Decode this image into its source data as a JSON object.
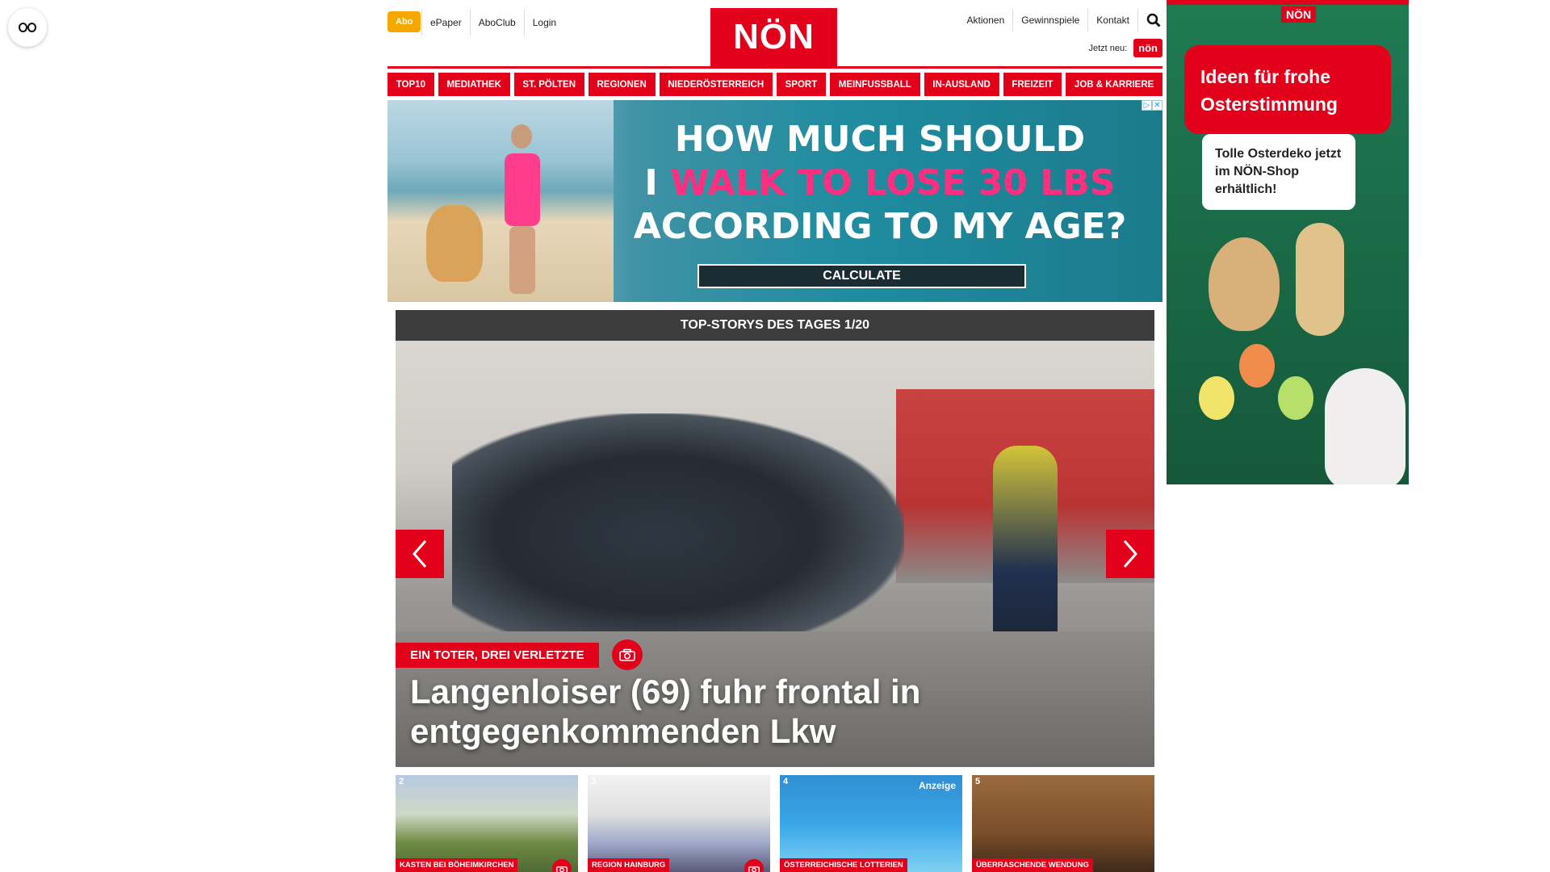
{
  "header": {
    "abo": "Abo",
    "links_left": [
      "ePaper",
      "AboClub",
      "Login"
    ],
    "logo": "NÖN",
    "links_right": [
      "Aktionen",
      "Gewinnspiele",
      "Kontakt"
    ],
    "jetzt_label": "Jetzt neu:",
    "jetzt_badge": "nön"
  },
  "nav": [
    "TOP10",
    "MEDIATHEK",
    "ST. PÖLTEN",
    "REGIONEN",
    "NIEDERÖSTERREICH",
    "SPORT",
    "MEINFUSSBALL",
    "IN-AUSLAND",
    "FREIZEIT",
    "JOB & KARRIERE"
  ],
  "banner": {
    "line1": "HOW MUCH SHOULD",
    "line2_pre": "I",
    "line2_pink": "WALK TO LOSE 30 LBS",
    "line3": "ACCORDING TO MY AGE?",
    "button": "CALCULATE"
  },
  "top_stories": {
    "header": "TOP-STORYS DES TAGES 1/20",
    "kicker": "EIN TOTER, DREI VERLETZTE",
    "title": "Langenloiser (69) fuhr frontal in entgegenkommenden Lkw"
  },
  "thumbs": [
    {
      "num": "2",
      "tag": "KASTEN BEI BÖHEIMKIRCHEN",
      "has_cam": true,
      "ad": ""
    },
    {
      "num": "3",
      "tag": "REGION HAINBURG",
      "has_cam": true,
      "ad": ""
    },
    {
      "num": "4",
      "tag": "ÖSTERREICHISCHE LOTTERIEN",
      "has_cam": false,
      "ad": "Anzeige"
    },
    {
      "num": "5",
      "tag": "ÜBERRASCHENDE WENDUNG",
      "has_cam": false,
      "ad": ""
    }
  ],
  "sidead": {
    "logo": "NÖN",
    "headline": "Ideen für frohe Osterstimmung",
    "note": "Tolle Osterdeko jetzt im NÖN-Shop erhältlich!"
  },
  "colors": {
    "brand_red": "#e3001b",
    "abo_yellow": "#f5a800",
    "dark_bar": "#3c3c3c"
  }
}
